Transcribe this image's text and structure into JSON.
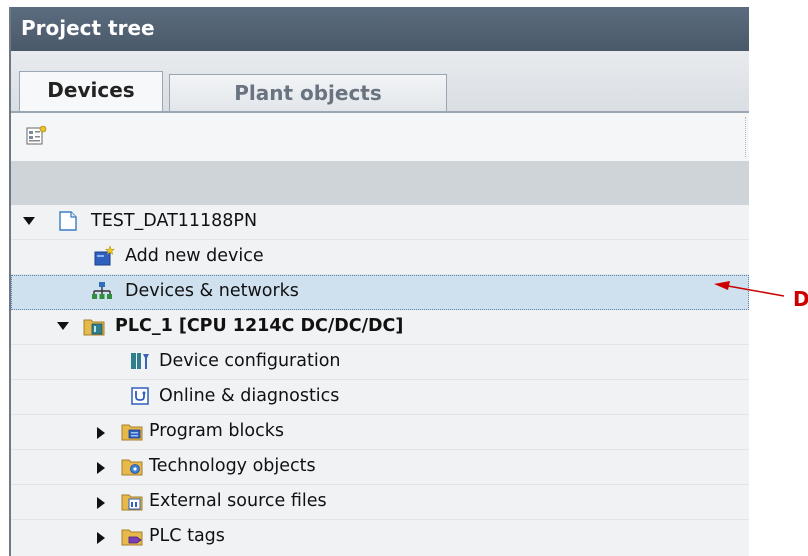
{
  "panel": {
    "title": "Project tree"
  },
  "tabs": [
    {
      "label": "Devices",
      "active": true
    },
    {
      "label": "Plant objects",
      "active": false
    }
  ],
  "toolbar": {
    "icons": [
      "project-view-icon"
    ]
  },
  "tree": {
    "items": [
      {
        "label": "TEST_DAT11188PN",
        "icon": "project-icon",
        "expander": "expanded",
        "bold": false
      },
      {
        "label": "Add new device",
        "icon": "add-device-icon",
        "expander": "none",
        "bold": false
      },
      {
        "label": "Devices & networks",
        "icon": "network-icon",
        "expander": "none",
        "bold": false,
        "selected": true
      },
      {
        "label": "PLC_1 [CPU 1214C DC/DC/DC]",
        "icon": "plc-folder-icon",
        "expander": "expanded",
        "bold": true
      },
      {
        "label": "Device configuration",
        "icon": "device-config-icon",
        "expander": "none",
        "bold": false
      },
      {
        "label": "Online & diagnostics",
        "icon": "diagnostics-icon",
        "expander": "none",
        "bold": false
      },
      {
        "label": "Program blocks",
        "icon": "program-blocks-folder-icon",
        "expander": "collapsed",
        "bold": false
      },
      {
        "label": "Technology objects",
        "icon": "technology-folder-icon",
        "expander": "collapsed",
        "bold": false
      },
      {
        "label": "External source files",
        "icon": "source-files-folder-icon",
        "expander": "collapsed",
        "bold": false
      },
      {
        "label": "PLC tags",
        "icon": "plc-tags-folder-icon",
        "expander": "collapsed",
        "bold": false
      }
    ]
  },
  "annotation": {
    "text": "D",
    "color": "#cc0000"
  },
  "colors": {
    "titlebar": "#4f5f70",
    "selection": "#cfe0ef",
    "accent": "#cc0000"
  }
}
